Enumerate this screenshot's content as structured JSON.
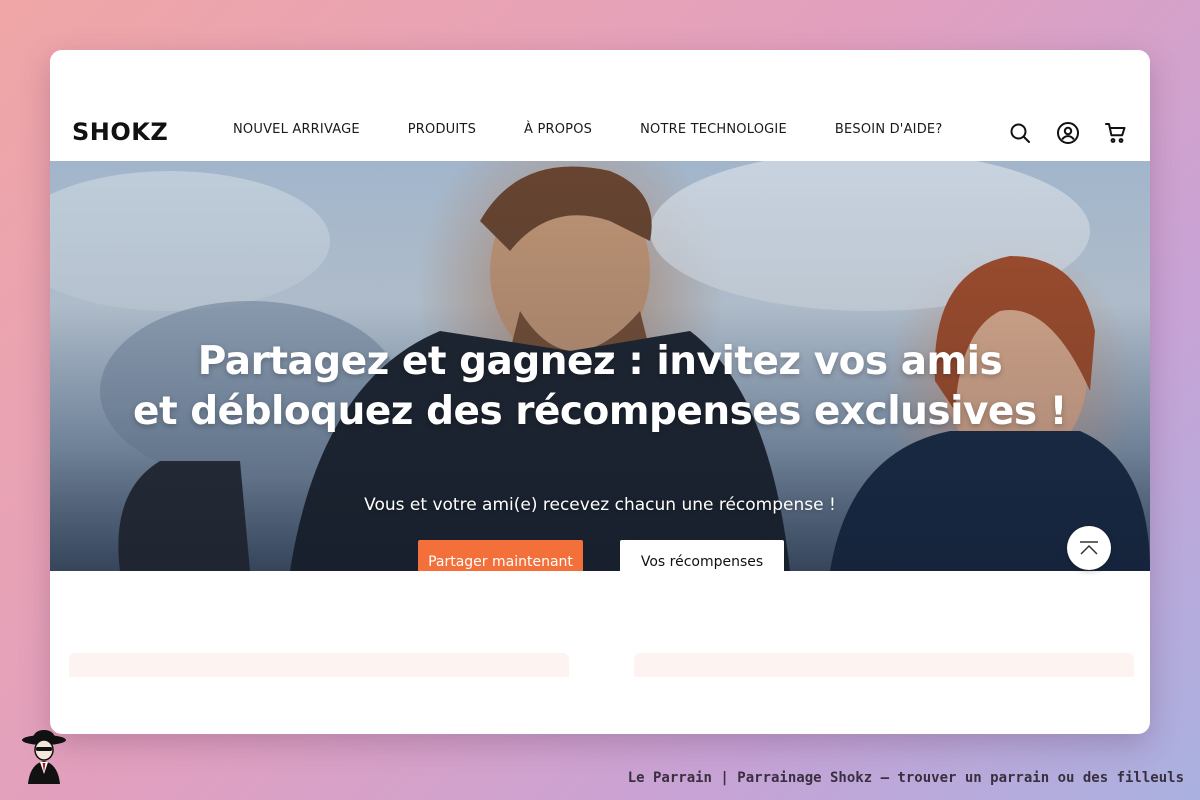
{
  "brand": {
    "logo_text": "SHOKZ"
  },
  "nav": {
    "items": [
      {
        "label": "NOUVEL ARRIVAGE"
      },
      {
        "label": "PRODUITS"
      },
      {
        "label": "À PROPOS"
      },
      {
        "label": "NOTRE TECHNOLOGIE"
      },
      {
        "label": "BESOIN D'AIDE?"
      }
    ]
  },
  "header_icons": [
    "search-icon",
    "account-icon",
    "cart-icon"
  ],
  "hero": {
    "title_line1": "Partagez et gagnez : invitez vos amis",
    "title_line2": "et débloquez des récompenses exclusives !",
    "subtitle": "Vous et votre ami(e) recevez chacun une récompense !",
    "primary_button": "Partager maintenant",
    "secondary_button": "Vos récompenses"
  },
  "colors": {
    "accent": "#f4703a",
    "card_bg": "#fdf3f1"
  },
  "footer": {
    "caption": "Le Parrain | Parrainage Shokz — trouver un parrain ou des filleuls"
  }
}
